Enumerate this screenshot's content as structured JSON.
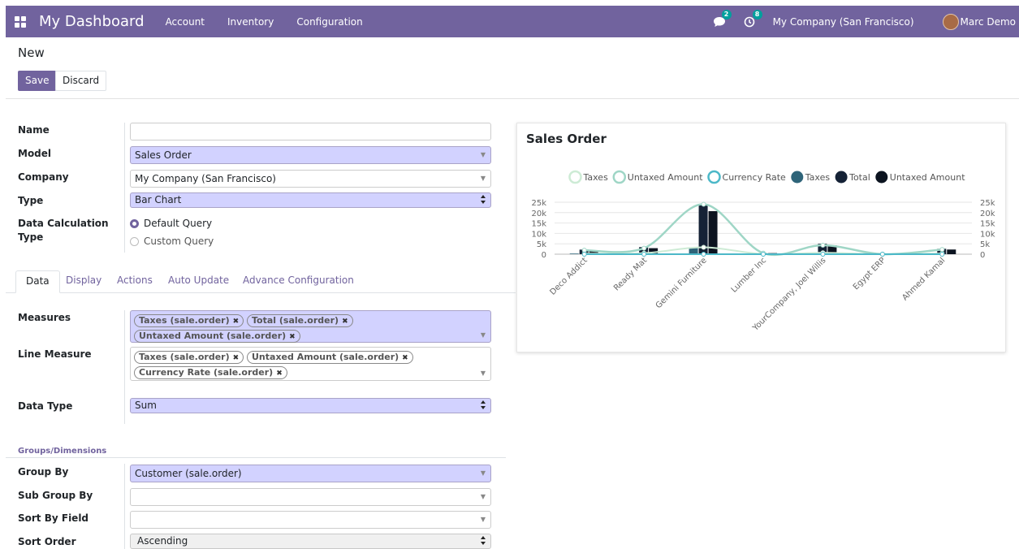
{
  "nav": {
    "brand": "My Dashboard",
    "menu": [
      "Account",
      "Inventory",
      "Configuration"
    ],
    "messages_count": "2",
    "activities_count": "8",
    "company": "My Company (San Francisco)",
    "user": "Marc Demo",
    "accent": "#71639e"
  },
  "page": {
    "title": "New",
    "save": "Save",
    "discard": "Discard"
  },
  "form": {
    "name": {
      "label": "Name",
      "value": ""
    },
    "model": {
      "label": "Model",
      "value": "Sales Order"
    },
    "company": {
      "label": "Company",
      "value": "My Company (San Francisco)"
    },
    "type": {
      "label": "Type",
      "value": "Bar Chart"
    },
    "calc": {
      "label_line1": "Data Calculation",
      "label_line2": "Type",
      "opt1": "Default Query",
      "opt2": "Custom Query"
    }
  },
  "tabs": [
    "Data",
    "Display",
    "Actions",
    "Auto Update",
    "Advance Configuration"
  ],
  "data_tab": {
    "measures_label": "Measures",
    "measures": [
      "Taxes (sale.order)",
      "Total (sale.order)",
      "Untaxed Amount (sale.order)"
    ],
    "line_measure_label": "Line Measure",
    "line_measures": [
      "Taxes (sale.order)",
      "Untaxed Amount (sale.order)",
      "Currency Rate (sale.order)"
    ],
    "data_type_label": "Data Type",
    "data_type": "Sum",
    "groups_title": "Groups/Dimensions",
    "group_by_label": "Group By",
    "group_by": "Customer (sale.order)",
    "sub_group_label": "Sub Group By",
    "sub_group": "",
    "sort_field_label": "Sort By Field",
    "sort_field": "",
    "sort_order_label": "Sort Order",
    "sort_order": "Ascending"
  },
  "chart_data": {
    "type": "bar",
    "title": "Sales Order",
    "categories": [
      "Deco Addict",
      "Ready Mat",
      "Gemini Furniture",
      "Lumber Inc",
      "YourCompany, Joel Willis",
      "Egypt ERP",
      "Ahmed Kamal"
    ],
    "yticks": [
      "25k",
      "20k",
      "15k",
      "10k",
      "5k",
      "0"
    ],
    "ylim": [
      0,
      25000
    ],
    "legend": [
      {
        "name": "Taxes",
        "kind": "line",
        "color": "#cdebd5"
      },
      {
        "name": "Untaxed Amount",
        "kind": "line",
        "color": "#9fd6c6"
      },
      {
        "name": "Currency Rate",
        "kind": "line",
        "color": "#4cb8c8"
      },
      {
        "name": "Taxes",
        "kind": "bar",
        "color": "#2e6479"
      },
      {
        "name": "Total",
        "kind": "bar",
        "color": "#152236"
      },
      {
        "name": "Untaxed Amount",
        "kind": "bar",
        "color": "#0c1420"
      }
    ],
    "series": [
      {
        "name": "Taxes",
        "kind": "bar",
        "values": [
          300,
          500,
          3300,
          80,
          700,
          0,
          350
        ]
      },
      {
        "name": "Total",
        "kind": "bar",
        "values": [
          2200,
          3400,
          24000,
          600,
          5000,
          0,
          2600
        ]
      },
      {
        "name": "Untaxed Amount",
        "kind": "bar",
        "values": [
          1900,
          2900,
          20700,
          520,
          4300,
          0,
          2250
        ]
      },
      {
        "name": "Taxes",
        "kind": "line",
        "values": [
          300,
          500,
          3300,
          80,
          700,
          0,
          350
        ]
      },
      {
        "name": "Untaxed Amount",
        "kind": "line",
        "values": [
          1900,
          2900,
          24000,
          520,
          4300,
          0,
          2250
        ]
      },
      {
        "name": "Currency Rate",
        "kind": "line",
        "values": [
          1,
          1,
          1,
          1,
          1,
          1,
          1
        ]
      }
    ]
  }
}
